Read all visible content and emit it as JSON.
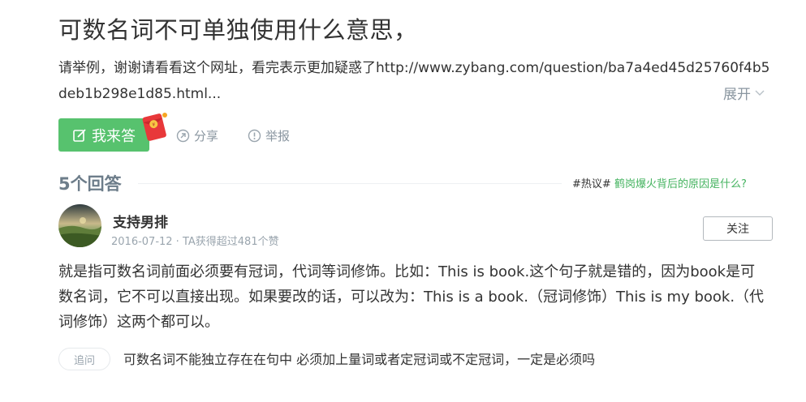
{
  "question": {
    "title": "可数名词不可单独使用什么意思，",
    "description": "请举例，谢谢请看看这个网址，看完表示更加疑惑了http://www.zybang.com/question/ba7a4ed45d25760f4b5deb1b298e1d85.html...",
    "expand_label": "展开"
  },
  "actions": {
    "answer_label": "我来答",
    "share_label": "分享",
    "report_label": "举报"
  },
  "answers_section": {
    "count_label": "5个回答",
    "hot_tag": "#热议#",
    "hot_link": "鹤岗爆火背后的原因是什么?"
  },
  "answer": {
    "username": "支持男排",
    "meta": "2016-07-12 · TA获得超过481个赞",
    "follow_label": "关注",
    "content": "就是指可数名词前面必须要有冠词，代词等词修饰。比如：This is book.这个句子就是错的，因为book是可数名词，它不可以直接出现。如果要改的话，可以改为：This is a book.（冠词修饰）This is my book.（代词修饰）这两个都可以。",
    "followup_badge": "追问",
    "followup_text": "可数名词不能独立存在在句中 必须加上量词或者定冠词或不定冠词，一定是必须吗"
  },
  "colors": {
    "accent_green": "#57c26e",
    "muted_gray": "#8a96a0",
    "hot_link_green": "#44b35f"
  },
  "icons": [
    "edit-icon",
    "red-envelope-icon",
    "share-icon",
    "report-icon",
    "chevron-down-icon"
  ]
}
